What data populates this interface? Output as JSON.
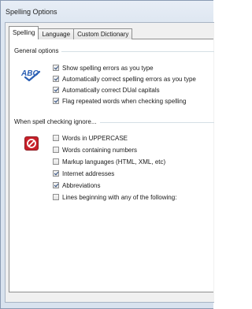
{
  "window": {
    "title": "Spelling Options"
  },
  "tabs": [
    {
      "label": "Spelling",
      "active": true
    },
    {
      "label": "Language",
      "active": false
    },
    {
      "label": "Custom Dictionary",
      "active": false
    }
  ],
  "general": {
    "header": "General options",
    "icon": "spellcheck-abc-icon",
    "options": [
      {
        "label": "Show spelling errors as you type",
        "checked": true
      },
      {
        "label": "Automatically correct spelling errors as you type",
        "checked": true
      },
      {
        "label": "Automatically correct DUal capitals",
        "checked": true
      },
      {
        "label": "Flag repeated words when checking spelling",
        "checked": true
      }
    ]
  },
  "ignore": {
    "header": "When spell checking ignore...",
    "icon": "stop-icon",
    "options": [
      {
        "label": "Words in UPPERCASE",
        "checked": false
      },
      {
        "label": "Words containing numbers",
        "checked": false
      },
      {
        "label": "Markup languages (HTML, XML, etc)",
        "checked": false
      },
      {
        "label": "Internet addresses",
        "checked": true
      },
      {
        "label": "Abbreviations",
        "checked": true
      },
      {
        "label": "Lines beginning with any of the following:",
        "checked": false
      }
    ]
  },
  "colors": {
    "accent": "#2b4a7d",
    "stop_red": "#c8202a",
    "abc_blue": "#2b5fb4"
  }
}
